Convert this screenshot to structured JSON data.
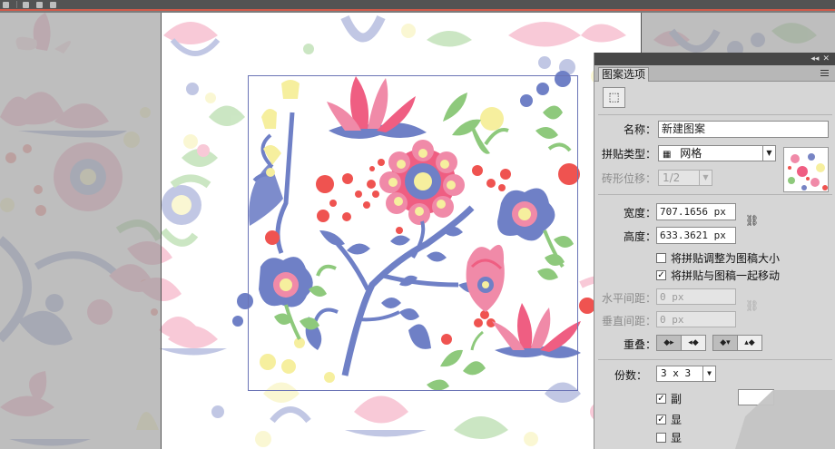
{
  "toolbar": {
    "item0": "",
    "item1": "",
    "item2": "",
    "item3": ""
  },
  "panel": {
    "title": "图案选项",
    "name_label": "名称：",
    "name_value": "新建图案",
    "tile_type_label": "拼贴类型：",
    "tile_type_value": "网格",
    "brick_offset_label": "砖形位移：",
    "brick_offset_value": "1/2",
    "width_label": "宽度：",
    "width_value": "707.1656 px",
    "height_label": "高度：",
    "height_value": "633.3621 px",
    "resize_tile_label": "将拼贴调整为图稿大小",
    "move_tile_label": "将拼贴与图稿一起移动",
    "h_spacing_label": "水平间距：",
    "h_spacing_value": "0 px",
    "v_spacing_label": "垂直间距：",
    "v_spacing_value": "0 px",
    "overlap_label": "重叠：",
    "copies_label": "份数：",
    "copies_value": "3 x 3",
    "dim_copies_label": "副",
    "show_tile_edge_label": "显",
    "show_swatch_bounds_label": "显",
    "checkbox_states": {
      "resize_tile": false,
      "move_tile": true,
      "dim_copies": true,
      "show_edge": true,
      "show_bounds": false
    }
  },
  "colors": {
    "pink": "#f08aa8",
    "red": "#ef5350",
    "blue": "#7784c4",
    "yellow": "#f6ef9e",
    "green": "#8ec97c",
    "panel_bg": "#d6d6d6",
    "dark_bar": "#535353"
  },
  "icons": {
    "tile_tool": "tile-edit-tool-icon",
    "grid": "grid-icon",
    "link": "link-chain-icon"
  }
}
